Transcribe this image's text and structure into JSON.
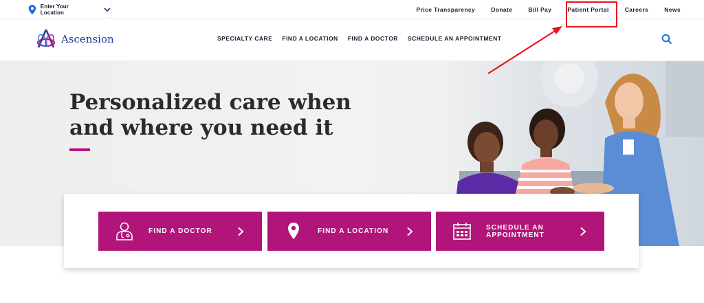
{
  "utility_bar": {
    "location_label": "Enter Your Location",
    "links": [
      "Price Transparency",
      "Donate",
      "Bill Pay",
      "Patient Portal",
      "Careers",
      "News"
    ]
  },
  "header": {
    "logo_text": "Ascension",
    "nav": [
      "SPECIALTY CARE",
      "FIND A LOCATION",
      "FIND A DOCTOR",
      "SCHEDULE AN APPOINTMENT"
    ]
  },
  "hero": {
    "title": "Personalized care when and where you need it"
  },
  "cta": [
    {
      "label": "FIND A DOCTOR",
      "icon": "doctor-icon"
    },
    {
      "label": "FIND A LOCATION",
      "icon": "map-pin-icon"
    },
    {
      "label": "SCHEDULE AN\nAPPOINTMENT",
      "icon": "calendar-icon"
    }
  ],
  "colors": {
    "brand_magenta": "#b2157a",
    "brand_blue": "#1c3f94",
    "annotation_red": "#e8141c"
  }
}
